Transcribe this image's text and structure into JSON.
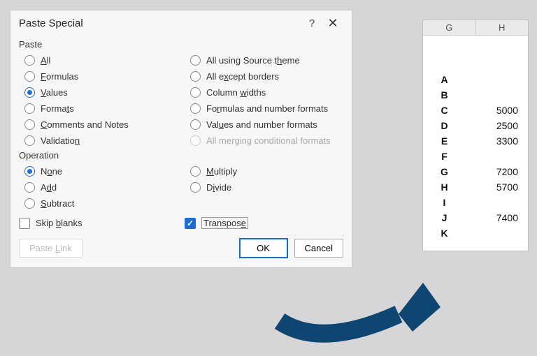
{
  "dialog": {
    "title": "Paste Special",
    "help": "?",
    "paste_group": "Paste",
    "operation_group": "Operation",
    "paste_left": [
      "All",
      "Formulas",
      "Values",
      "Formats",
      "Comments and Notes",
      "Validation"
    ],
    "paste_left_underline": [
      "A",
      "F",
      "V",
      "T",
      "C",
      "N"
    ],
    "paste_right": [
      "All using Source theme",
      "All except borders",
      "Column widths",
      "Formulas and number formats",
      "Values and number formats",
      "All merging conditional formats"
    ],
    "paste_right_underline": [
      "H",
      "X",
      "W",
      "R",
      "U",
      ""
    ],
    "paste_selected": "Values",
    "paste_disabled": "All merging conditional formats",
    "op_left": [
      "None",
      "Add",
      "Subtract"
    ],
    "op_left_underline": [
      "O",
      "D",
      "S"
    ],
    "op_right": [
      "Multiply",
      "Divide"
    ],
    "op_right_underline": [
      "M",
      "I"
    ],
    "op_selected": "None",
    "skip_blanks": "Skip blanks",
    "skip_blanks_underline": "b",
    "transpose": "Transpose",
    "transpose_underline": "E",
    "transpose_checked": true,
    "paste_link": "Paste Link",
    "paste_link_underline": "L",
    "ok": "OK",
    "cancel": "Cancel"
  },
  "sheet": {
    "col1": "G",
    "col2": "H",
    "rows": [
      {
        "g": "A",
        "h": ""
      },
      {
        "g": "B",
        "h": ""
      },
      {
        "g": "C",
        "h": "5000"
      },
      {
        "g": "D",
        "h": "2500"
      },
      {
        "g": "E",
        "h": "3300"
      },
      {
        "g": "F",
        "h": ""
      },
      {
        "g": "G",
        "h": "7200"
      },
      {
        "g": "H",
        "h": "5700"
      },
      {
        "g": "I",
        "h": ""
      },
      {
        "g": "J",
        "h": "7400"
      },
      {
        "g": "K",
        "h": ""
      }
    ]
  }
}
